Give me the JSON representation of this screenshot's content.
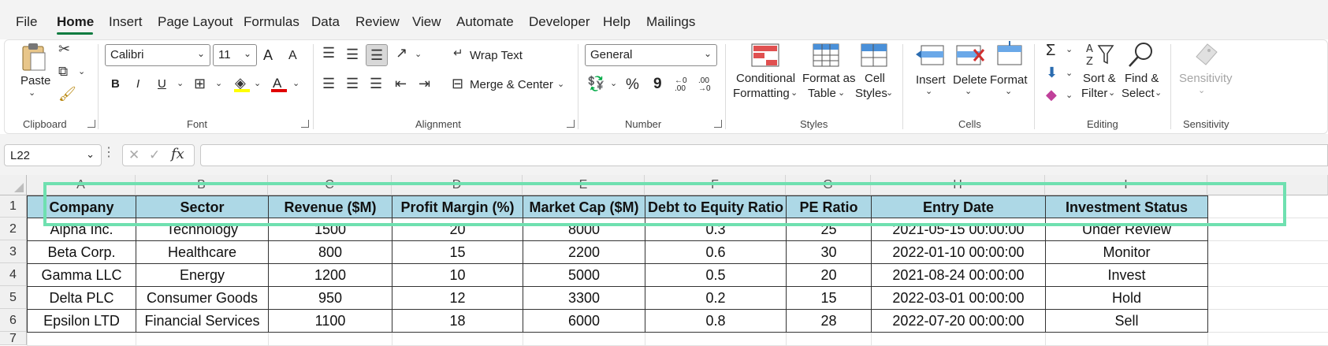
{
  "menu": {
    "tabs": [
      "File",
      "Home",
      "Insert",
      "Page Layout",
      "Formulas",
      "Data",
      "Review",
      "View",
      "Automate",
      "Developer",
      "Help",
      "Mailings"
    ],
    "active": "Home"
  },
  "ribbon": {
    "clipboard": {
      "paste": "Paste",
      "label": "Clipboard"
    },
    "font": {
      "name": "Calibri",
      "size": "11",
      "grow": "A",
      "shrink": "A",
      "bold": "B",
      "italic": "I",
      "underline": "U",
      "font_color": "A",
      "label": "Font"
    },
    "alignment": {
      "wrap_text": "Wrap Text",
      "merge_center": "Merge & Center",
      "label": "Alignment"
    },
    "number": {
      "format": "General",
      "percent": "%",
      "comma": "9",
      "inc_decimal": "←0 .00",
      "dec_decimal": ".00 →0",
      "label": "Number"
    },
    "styles": {
      "conditional_1": "Conditional",
      "conditional_2": "Formatting",
      "format_table_1": "Format as",
      "format_table_2": "Table",
      "cell_styles_1": "Cell",
      "cell_styles_2": "Styles",
      "label": "Styles"
    },
    "cells": {
      "insert": "Insert",
      "delete": "Delete",
      "format": "Format",
      "label": "Cells"
    },
    "editing": {
      "sum": "Σ",
      "sort_1": "Sort &",
      "sort_2": "Filter",
      "find_1": "Find &",
      "find_2": "Select",
      "label": "Editing"
    },
    "sensitivity": {
      "button": "Sensitivity",
      "label": "Sensitivity"
    }
  },
  "formula_bar": {
    "name_box": "L22",
    "fx": "fx",
    "formula": ""
  },
  "sheet": {
    "columns": [
      "A",
      "B",
      "C",
      "D",
      "E",
      "F",
      "G",
      "H",
      "I"
    ],
    "rows": [
      "1",
      "2",
      "3",
      "4",
      "5",
      "6",
      "7"
    ],
    "header": [
      "Company",
      "Sector",
      "Revenue ($M)",
      "Profit Margin (%)",
      "Market Cap ($M)",
      "Debt to Equity Ratio",
      "PE Ratio",
      "Entry Date",
      "Investment Status"
    ],
    "data": [
      [
        "Alpha Inc.",
        "Technology",
        "1500",
        "20",
        "8000",
        "0.3",
        "25",
        "2021-05-15 00:00:00",
        "Under Review"
      ],
      [
        "Beta Corp.",
        "Healthcare",
        "800",
        "15",
        "2200",
        "0.6",
        "30",
        "2022-01-10 00:00:00",
        "Monitor"
      ],
      [
        "Gamma LLC",
        "Energy",
        "1200",
        "10",
        "5000",
        "0.5",
        "20",
        "2021-08-24 00:00:00",
        "Invest"
      ],
      [
        "Delta PLC",
        "Consumer Goods",
        "950",
        "12",
        "3300",
        "0.2",
        "15",
        "2022-03-01 00:00:00",
        "Hold"
      ],
      [
        "Epsilon LTD",
        "Financial Services",
        "1100",
        "18",
        "6000",
        "0.8",
        "28",
        "2022-07-20 00:00:00",
        "Sell"
      ]
    ]
  },
  "colors": {
    "accent": "#107c41",
    "header_fill": "#add8e6",
    "highlight": "#6fe0b0"
  }
}
